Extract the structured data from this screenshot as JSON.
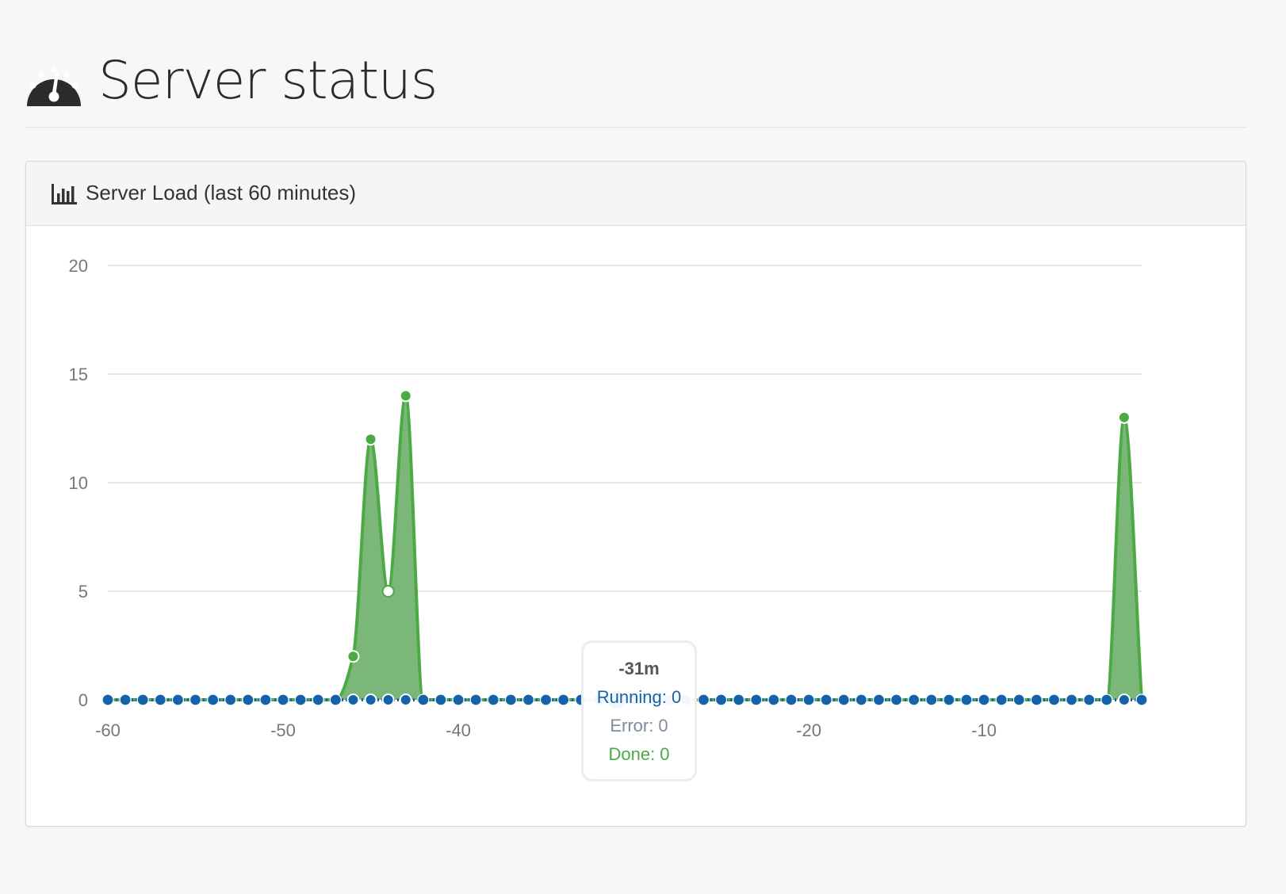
{
  "page": {
    "title": "Server status",
    "icon": "dashboard-gauge-icon"
  },
  "panel": {
    "icon": "bar-chart-icon",
    "title": "Server Load (last 60 minutes)"
  },
  "tooltip": {
    "title": "-31m",
    "lines": [
      {
        "label": "Running: 0",
        "color": "#1463aa"
      },
      {
        "label": "Error: 0",
        "color": "#7f8c99"
      },
      {
        "label": "Done: 0",
        "color": "#4caa45"
      }
    ]
  },
  "colors": {
    "running": "#1463aa",
    "done": "#4caa45",
    "done_fill": "#7bb779",
    "grid": "#cccccc",
    "axis_text": "#777777"
  },
  "chart_data": {
    "type": "area",
    "x": [
      -60,
      -59,
      -58,
      -57,
      -56,
      -55,
      -54,
      -53,
      -52,
      -51,
      -50,
      -49,
      -48,
      -47,
      -46,
      -45,
      -44,
      -43,
      -42,
      -41,
      -40,
      -39,
      -38,
      -37,
      -36,
      -35,
      -34,
      -33,
      -32,
      -31,
      -30,
      -29,
      -28,
      -27,
      -26,
      -25,
      -24,
      -23,
      -22,
      -21,
      -20,
      -19,
      -18,
      -17,
      -16,
      -15,
      -14,
      -13,
      -12,
      -11,
      -10,
      -9,
      -8,
      -7,
      -6,
      -5,
      -4,
      -3,
      -2,
      -1
    ],
    "series": [
      {
        "name": "Running",
        "color": "#1463aa",
        "values": [
          0,
          0,
          0,
          0,
          0,
          0,
          0,
          0,
          0,
          0,
          0,
          0,
          0,
          0,
          0,
          0,
          0,
          0,
          0,
          0,
          0,
          0,
          0,
          0,
          0,
          0,
          0,
          0,
          0,
          0,
          0,
          0,
          0,
          0,
          0,
          0,
          0,
          0,
          0,
          0,
          0,
          0,
          0,
          0,
          0,
          0,
          0,
          0,
          0,
          0,
          0,
          0,
          0,
          0,
          0,
          0,
          0,
          0,
          0,
          0
        ]
      },
      {
        "name": "Error",
        "color": "#7f8c99",
        "values": [
          0,
          0,
          0,
          0,
          0,
          0,
          0,
          0,
          0,
          0,
          0,
          0,
          0,
          0,
          0,
          0,
          0,
          0,
          0,
          0,
          0,
          0,
          0,
          0,
          0,
          0,
          0,
          0,
          0,
          0,
          0,
          0,
          0,
          0,
          0,
          0,
          0,
          0,
          0,
          0,
          0,
          0,
          0,
          0,
          0,
          0,
          0,
          0,
          0,
          0,
          0,
          0,
          0,
          0,
          0,
          0,
          0,
          0,
          0,
          0
        ]
      },
      {
        "name": "Done",
        "color": "#4caa45",
        "values": [
          0,
          0,
          0,
          0,
          0,
          0,
          0,
          0,
          0,
          0,
          0,
          0,
          0,
          0,
          2,
          12,
          5,
          14,
          0,
          0,
          0,
          0,
          0,
          0,
          0,
          0,
          0,
          0,
          0,
          0,
          0,
          0,
          0,
          0,
          0,
          0,
          0,
          0,
          0,
          0,
          0,
          0,
          0,
          0,
          0,
          0,
          0,
          0,
          0,
          0,
          0,
          0,
          0,
          0,
          0,
          0,
          0,
          0,
          13,
          0
        ]
      }
    ],
    "highlight_x": -31,
    "xticks": [
      "-60",
      "-50",
      "-40",
      "-30",
      "-20",
      "-10"
    ],
    "yticks": [
      "0",
      "5",
      "10",
      "15",
      "20"
    ],
    "ylim": [
      0,
      20
    ],
    "xlim": [
      -60,
      -1
    ],
    "grid": true
  }
}
